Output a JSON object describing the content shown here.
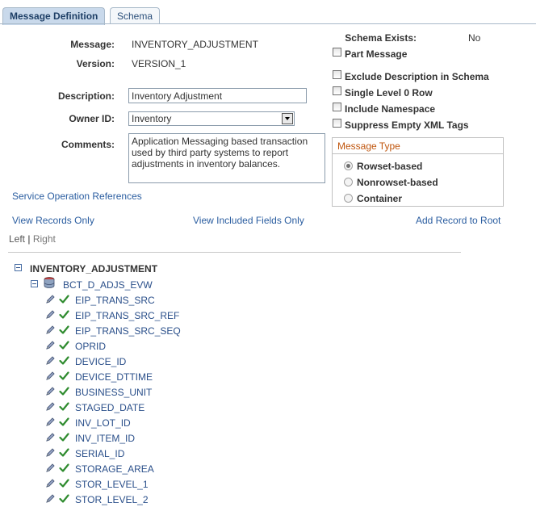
{
  "tabs": [
    {
      "label": "Message Definition",
      "active": true
    },
    {
      "label": "Schema",
      "active": false
    }
  ],
  "form": {
    "message_label": "Message:",
    "message_value": "INVENTORY_ADJUSTMENT",
    "version_label": "Version:",
    "version_value": "VERSION_1",
    "description_label": "Description:",
    "description_value": "Inventory Adjustment",
    "owner_label": "Owner ID:",
    "owner_value": "Inventory",
    "comments_label": "Comments:",
    "comments_value": "Application Messaging based transaction used by third party systems to report adjustments in inventory balances."
  },
  "schema": {
    "exists_label": "Schema Exists:",
    "exists_value": "No"
  },
  "options": {
    "part_message": "Part Message",
    "exclude_description": "Exclude Description in Schema",
    "single_level": "Single Level 0 Row",
    "include_namespace": "Include Namespace",
    "suppress_empty": "Suppress Empty XML Tags"
  },
  "message_type": {
    "title": "Message Type",
    "options": [
      "Rowset-based",
      "Nonrowset-based",
      "Container"
    ],
    "selected": "Rowset-based"
  },
  "links": {
    "service_operation_refs": "Service Operation References",
    "view_records_only": "View Records Only",
    "view_included_fields": "View Included Fields Only",
    "add_record_to_root": "Add Record to Root"
  },
  "alignment": {
    "left": "Left",
    "separator": "|",
    "right": "Right"
  },
  "tree": {
    "root": "INVENTORY_ADJUSTMENT",
    "record": "BCT_D_ADJS_EVW",
    "fields": [
      "EIP_TRANS_SRC",
      "EIP_TRANS_SRC_REF",
      "EIP_TRANS_SRC_SEQ",
      "OPRID",
      "DEVICE_ID",
      "DEVICE_DTTIME",
      "BUSINESS_UNIT",
      "STAGED_DATE",
      "INV_LOT_ID",
      "INV_ITEM_ID",
      "SERIAL_ID",
      "STORAGE_AREA",
      "STOR_LEVEL_1",
      "STOR_LEVEL_2"
    ]
  },
  "colors": {
    "link": "#2a5da0",
    "tab_active": "#c9d9eb",
    "group_title": "#c0560e",
    "check_icon": "#2e8b2e"
  }
}
